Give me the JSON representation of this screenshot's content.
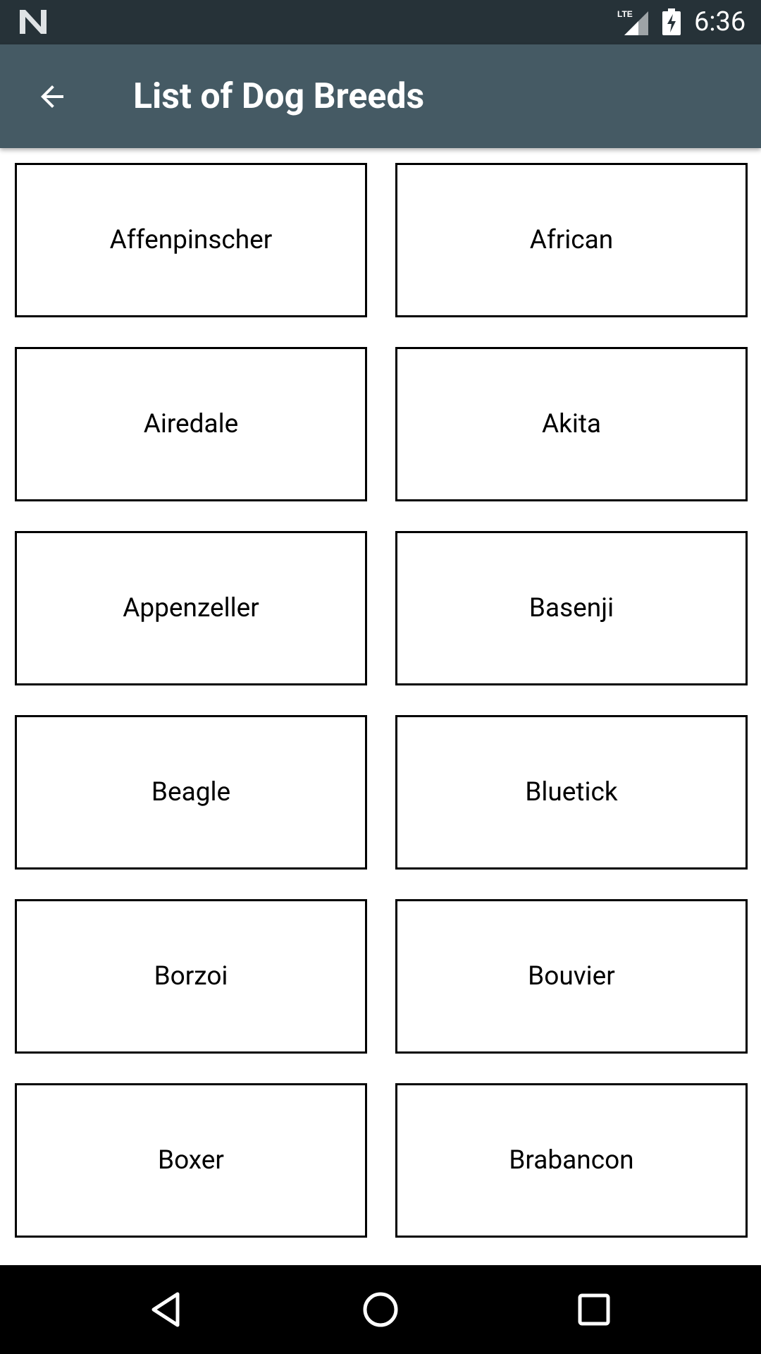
{
  "status_bar": {
    "network": "LTE",
    "time": "6:36",
    "icons": [
      "n-notification-icon",
      "lte-signal-icon",
      "battery-charging-icon"
    ]
  },
  "app_bar": {
    "title": "List of Dog Breeds",
    "back_icon": "arrow-back-icon",
    "background_color": "#455a64"
  },
  "breeds": [
    "Affenpinscher",
    "African",
    "Airedale",
    "Akita",
    "Appenzeller",
    "Basenji",
    "Beagle",
    "Bluetick",
    "Borzoi",
    "Bouvier",
    "Boxer",
    "Brabancon"
  ],
  "nav_bar": {
    "icons": [
      "nav-back-triangle-icon",
      "nav-home-circle-icon",
      "nav-recents-square-icon"
    ]
  },
  "colors": {
    "status_bar": "#263238",
    "app_bar": "#455a64",
    "card_border": "#000000",
    "nav_bar": "#000000"
  }
}
